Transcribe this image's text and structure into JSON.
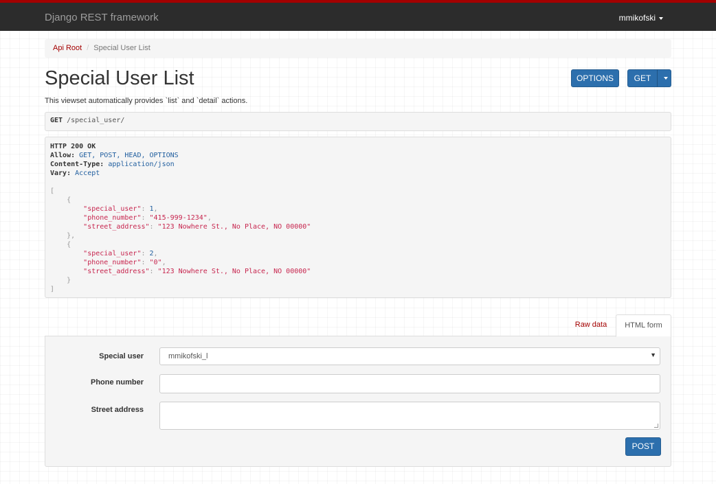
{
  "navbar": {
    "brand": "Django REST framework",
    "username": "mmikofski"
  },
  "breadcrumb": {
    "root": "Api Root",
    "current": "Special User List"
  },
  "page": {
    "title": "Special User List",
    "description": "This viewset automatically provides `list` and `detail` actions."
  },
  "actions": {
    "options_label": "OPTIONS",
    "get_label": "GET"
  },
  "request": {
    "method": "GET",
    "path": "/special_user/"
  },
  "response": {
    "status": "HTTP 200 OK",
    "headers": [
      {
        "key": "Allow:",
        "value": "GET, POST, HEAD, OPTIONS"
      },
      {
        "key": "Content-Type:",
        "value": "application/json"
      },
      {
        "key": "Vary:",
        "value": "Accept"
      }
    ],
    "body": [
      {
        "special_user": 1,
        "phone_number": "\"415-999-1234\"",
        "street_address": "\"123 Nowhere St., No Place, NO 00000\""
      },
      {
        "special_user": 2,
        "phone_number": "\"0\"",
        "street_address": "\"123 Nowhere St., No Place, NO 00000\""
      }
    ],
    "keys": {
      "special_user": "\"special_user\"",
      "phone_number": "\"phone_number\"",
      "street_address": "\"street_address\""
    }
  },
  "tabs": {
    "raw": "Raw data",
    "html": "HTML form"
  },
  "form": {
    "special_user_label": "Special user",
    "special_user_value": "mmikofski_l",
    "phone_label": "Phone number",
    "phone_value": "",
    "address_label": "Street address",
    "address_value": "",
    "submit_label": "POST"
  },
  "colors": {
    "brand_red": "#a30000",
    "navbar_bg": "#2c2c2c",
    "button_blue": "#2c6fad"
  }
}
